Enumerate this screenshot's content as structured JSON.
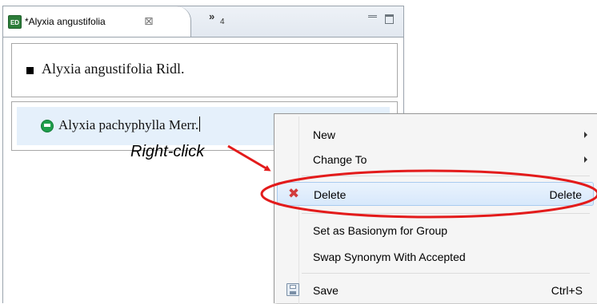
{
  "editor": {
    "tab": {
      "title": "*Alyxia angustifolia",
      "icon": "editor-app-icon",
      "icon_text": "ED",
      "close_glyph": "⊠"
    },
    "overflow": {
      "glyph": "»",
      "count": "4"
    },
    "accepted_taxon": "Alyxia angustifolia Ridl.",
    "synonym_taxon": "Alyxia pachyphylla Merr."
  },
  "annotation": {
    "label": "Right-click",
    "color": "#e31b1b"
  },
  "context_menu": {
    "items": [
      {
        "label": "New",
        "submenu": true
      },
      {
        "label": "Change To",
        "submenu": true
      },
      {
        "label": "Delete",
        "shortcut": "Delete",
        "icon": "delete-icon",
        "highlighted": true
      },
      {
        "label": "Set as Basionym for Group"
      },
      {
        "label": "Swap Synonym With Accepted"
      },
      {
        "label": "Save",
        "shortcut": "Ctrl+S",
        "icon": "save-icon"
      }
    ]
  },
  "colors": {
    "selection_row": "#e5f0fb",
    "synonym_icon": "#1f9e4c",
    "annotation_red": "#e31b1b"
  }
}
